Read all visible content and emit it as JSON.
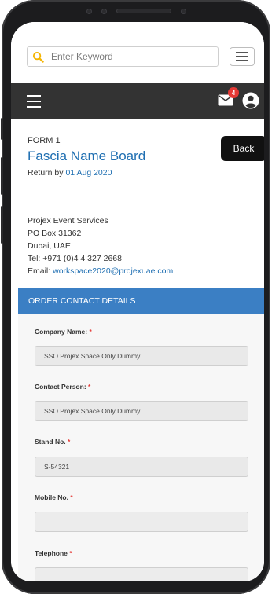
{
  "search": {
    "placeholder": "Enter Keyword"
  },
  "nav": {
    "notification_count": "4"
  },
  "form": {
    "number": "FORM 1",
    "title": "Fascia Name Board",
    "return_label": "Return by",
    "return_date": "01 Aug 2020",
    "back_label": "Back"
  },
  "address": {
    "company": "Projex Event Services",
    "po_box": "PO Box 31362",
    "city": "Dubai, UAE",
    "tel": "Tel: +971 (0)4 4 327 2668",
    "email_label": "Email:",
    "email": "workspace2020@projexuae.com"
  },
  "section": {
    "title": "ORDER CONTACT DETAILS"
  },
  "fields": {
    "company_name": {
      "label": "Company Name:",
      "value": "SSO Projex Space Only Dummy"
    },
    "contact_person": {
      "label": "Contact Person:",
      "value": "SSO Projex Space Only Dummy"
    },
    "stand_no": {
      "label": "Stand No.",
      "value": "S-54321"
    },
    "mobile_no": {
      "label": "Mobile No.",
      "value": ""
    },
    "telephone": {
      "label": "Telephone",
      "value": ""
    },
    "required_mark": "*"
  },
  "colors": {
    "accent": "#1f6fb2",
    "section_bar": "#3b7fc4",
    "navbar": "#333333",
    "badge": "#e53935",
    "search_icon": "#f4b400"
  }
}
